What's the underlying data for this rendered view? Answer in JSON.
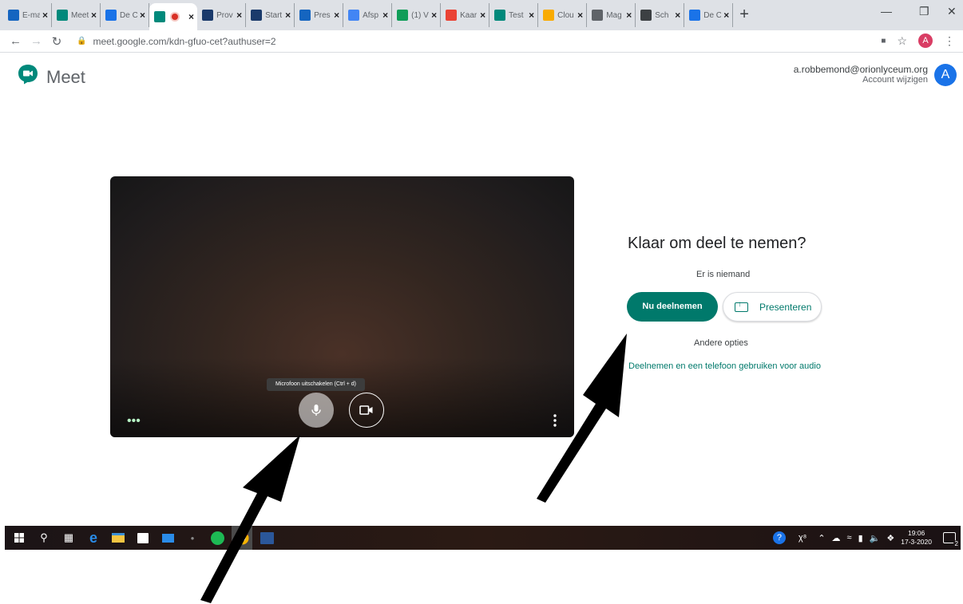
{
  "browser": {
    "tabs": [
      {
        "label": "E-mail",
        "color": "#1565c0"
      },
      {
        "label": "Meet",
        "color": "#00897b"
      },
      {
        "label": "De Cal",
        "color": "#1a73e8"
      },
      {
        "label": "",
        "color": "#00897b"
      },
      {
        "label": "Prov",
        "color": "#1a3a6b"
      },
      {
        "label": "Start",
        "color": "#1a3a6b"
      },
      {
        "label": "Pres",
        "color": "#1565c0"
      },
      {
        "label": "Afsp",
        "color": "#4285f4"
      },
      {
        "label": "(1) V",
        "color": "#0f9d58"
      },
      {
        "label": "Kaar",
        "color": "#ea4335"
      },
      {
        "label": "Test",
        "color": "#00897b"
      },
      {
        "label": "Clou",
        "color": "#f9ab00"
      },
      {
        "label": "Mag",
        "color": "#5f6368"
      },
      {
        "label": "Sch",
        "color": "#3c4043"
      },
      {
        "label": "De C",
        "color": "#1a73e8"
      }
    ],
    "active_tab_index": 3,
    "new_tab": "+",
    "url": "meet.google.com/kdn-gfuo-cet?authuser=2",
    "profile_initial": "A"
  },
  "meet": {
    "app_name": "Meet",
    "account_email": "a.robbemond@orionlyceum.org",
    "account_change": "Account wijzigen",
    "avatar_initial": "A",
    "mic_tooltip": "Microfoon uitschakelen (Ctrl + d)",
    "ready_title": "Klaar om deel te nemen?",
    "participants_status": "Er is niemand",
    "join_label": "Nu deelnemen",
    "present_label": "Presenteren",
    "other_options": "Andere opties",
    "phone_audio_link": "Deelnemen en een telefoon gebruiken voor audio"
  },
  "taskbar": {
    "time": "19:06",
    "date": "17-3-2020",
    "notification_count": "2"
  },
  "colors": {
    "accent": "#00796b",
    "tabstrip": "#dee1e6"
  }
}
